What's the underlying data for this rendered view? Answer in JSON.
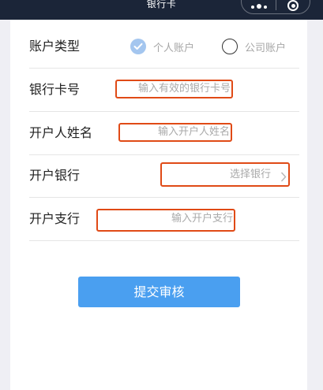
{
  "navbar": {
    "title": "银行卡",
    "more_icon": "more-dots-icon",
    "close_icon": "target-circle-icon"
  },
  "form": {
    "account_type": {
      "label": "账户类型",
      "options": [
        {
          "label": "个人账户",
          "checked": true
        },
        {
          "label": "公司账户",
          "checked": false
        }
      ]
    },
    "card_number": {
      "label": "银行卡号",
      "placeholder": "输入有效的银行卡号"
    },
    "holder_name": {
      "label": "开户人姓名",
      "placeholder": "输入开户人姓名"
    },
    "bank": {
      "label": "开户银行",
      "placeholder": "选择银行",
      "icon": "chevron-right-icon"
    },
    "branch": {
      "label": "开户支行",
      "placeholder": "输入开户支行"
    }
  },
  "submit": {
    "label": "提交审核"
  },
  "colors": {
    "navbar_bg": "#1b2538",
    "accent": "#4a9ff0",
    "highlight_border": "#e04a16",
    "placeholder": "#a9a9a9"
  }
}
